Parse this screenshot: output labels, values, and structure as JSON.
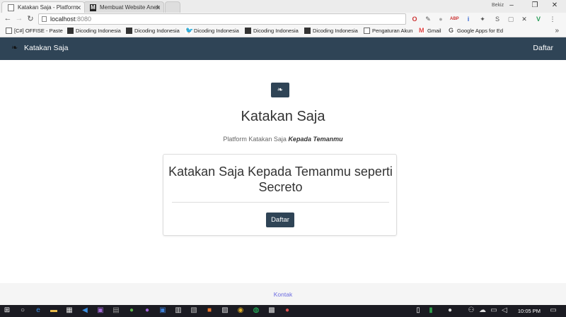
{
  "browser": {
    "tabs": [
      {
        "title": "Katakan Saja - Platform",
        "active": true
      },
      {
        "title": "Membuat Website Aneh",
        "active": false
      }
    ],
    "user": "Bekiz",
    "url_host": "localhost",
    "url_port": ":8080"
  },
  "bookmarks": [
    {
      "label": "[C#] OFFISE - Paste",
      "icon": "page-icon"
    },
    {
      "label": "Dicoding Indonesia",
      "icon": "dicoding-icon"
    },
    {
      "label": "Dicoding Indonesia",
      "icon": "dicoding-icon"
    },
    {
      "label": "Dicoding Indonesia",
      "icon": "twitter-icon"
    },
    {
      "label": "Dicoding Indonesia",
      "icon": "dicoding-icon"
    },
    {
      "label": "Dicoding Indonesia",
      "icon": "dicoding-icon"
    },
    {
      "label": "Pengaturan Akun",
      "icon": "page-icon"
    },
    {
      "label": "Gmail",
      "icon": "gmail-icon"
    },
    {
      "label": "Google Apps for Ed",
      "icon": "google-icon"
    }
  ],
  "navbar": {
    "brand": "Katakan Saja",
    "daftar": "Daftar"
  },
  "hero": {
    "title": "Katakan Saja",
    "subtitle_plain": "Platform Katakan Saja",
    "subtitle_emphasis": "Kepada Temanmu"
  },
  "card": {
    "title": "Katakan Saja Kepada Temanmu seperti Secreto",
    "button": "Daftar"
  },
  "footer": {
    "link": "Kontak"
  },
  "taskbar": {
    "time": "10:05 PM"
  },
  "colors": {
    "navbar": "#2f4456",
    "link": "#6b6be0"
  }
}
